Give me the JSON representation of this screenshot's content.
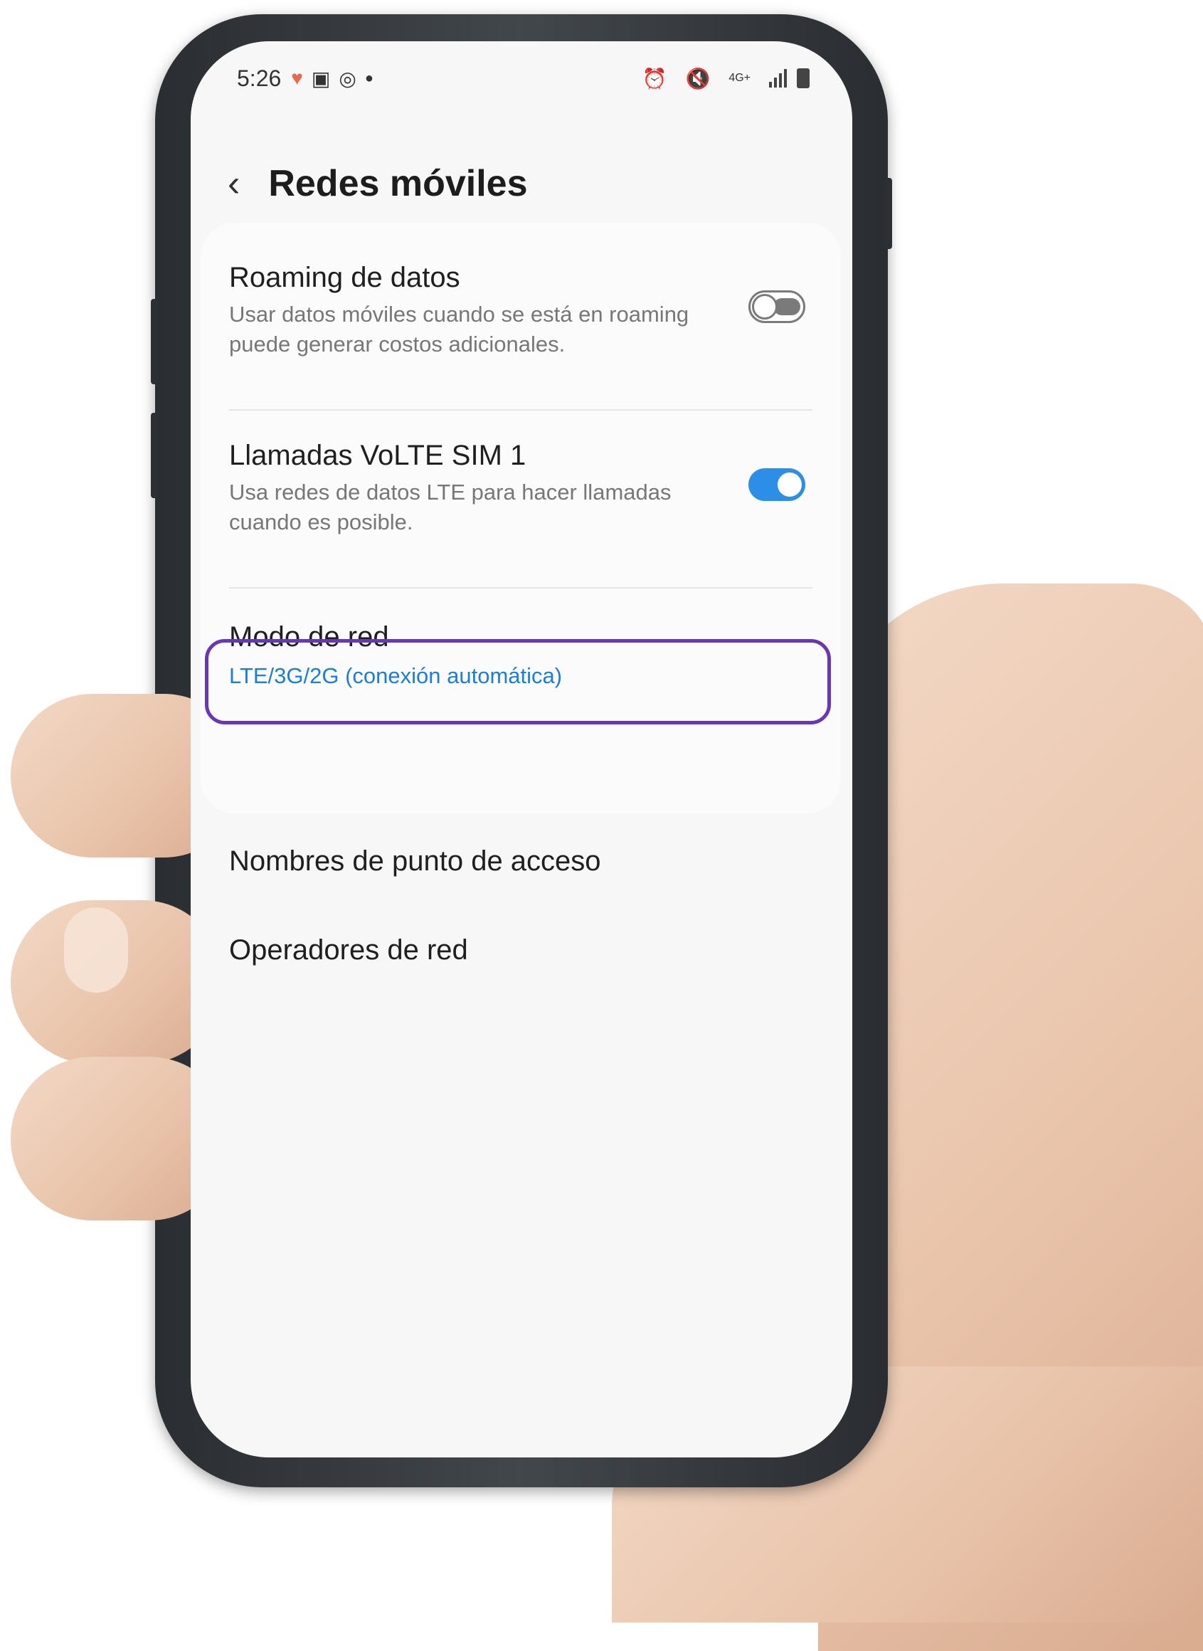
{
  "status_bar": {
    "time": "5:26",
    "network": "4G+",
    "icons_left": [
      "heart-icon",
      "gallery-icon",
      "whatsapp-icon",
      "dot-icon"
    ],
    "icons_right": [
      "alarm-icon",
      "mute-icon",
      "network-4g-icon",
      "signal-icon",
      "battery-icon"
    ]
  },
  "header": {
    "title": "Redes móviles"
  },
  "settings": {
    "roaming": {
      "title": "Roaming de datos",
      "subtitle_line1": "Usar datos móviles cuando se está en roaming",
      "subtitle_line2": "puede generar costos adicionales.",
      "enabled": false
    },
    "volte": {
      "title": "Llamadas VoLTE SIM 1",
      "subtitle_line1": "Usa redes de datos LTE para hacer llamadas",
      "subtitle_line2": "cuando es posible.",
      "enabled": true
    },
    "network_mode": {
      "title": "Modo de red",
      "value": "LTE/3G/2G (conexión automática)"
    },
    "apn": {
      "title": "Nombres de punto de acceso",
      "highlighted": true
    },
    "operators": {
      "title": "Operadores de red"
    }
  },
  "colors": {
    "accent": "#2d8ee8",
    "link": "#1c7ed6",
    "highlight": "#6b36b4"
  }
}
